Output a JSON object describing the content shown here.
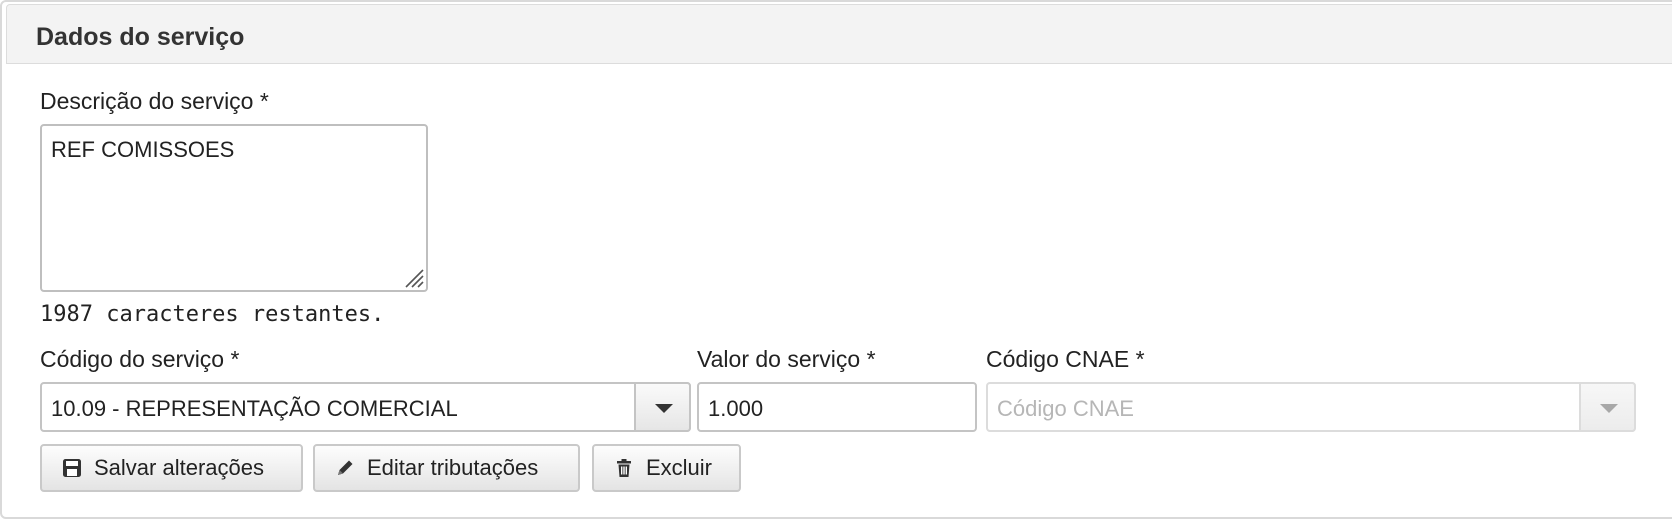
{
  "panel": {
    "title": "Dados do serviço"
  },
  "description": {
    "label": "Descrição do serviço *",
    "value": "REF COMISSOES",
    "remaining": "1987 caracteres restantes."
  },
  "service_code": {
    "label": "Código do serviço *",
    "value": "10.09 - REPRESENTAÇÃO COMERCIAL"
  },
  "service_value": {
    "label": "Valor do serviço *",
    "value": "1.000"
  },
  "cnae": {
    "label": "Código CNAE *",
    "placeholder": "Código CNAE"
  },
  "buttons": {
    "save": "Salvar alterações",
    "edit_taxes": "Editar tributações",
    "delete": "Excluir"
  },
  "icons": {
    "save": "floppy-disk-icon",
    "edit": "pencil-icon",
    "delete": "trash-icon",
    "dropdown": "caret-down-icon"
  }
}
